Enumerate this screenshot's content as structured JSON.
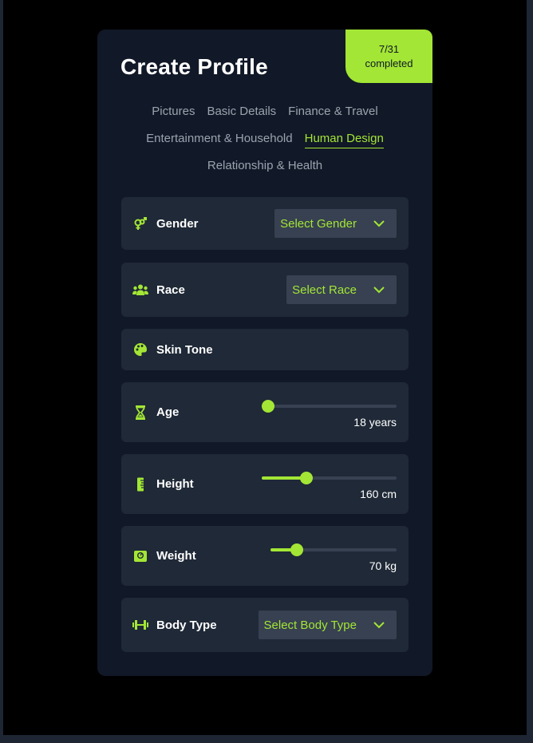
{
  "header": {
    "title": "Create Profile",
    "progress_count": "7/31",
    "progress_label": "completed"
  },
  "tabs": [
    {
      "label": "Pictures",
      "active": false
    },
    {
      "label": "Basic Details",
      "active": false
    },
    {
      "label": "Finance & Travel",
      "active": false
    },
    {
      "label": "Entertainment & Household",
      "active": false
    },
    {
      "label": "Human Design",
      "active": true
    },
    {
      "label": "Relationship & Health",
      "active": false
    }
  ],
  "fields": {
    "gender": {
      "label": "Gender",
      "icon": "gender-icon",
      "select": "Select Gender"
    },
    "race": {
      "label": "Race",
      "icon": "users-icon",
      "select": "Select Race"
    },
    "skin_tone": {
      "label": "Skin Tone",
      "icon": "palette-icon"
    },
    "age": {
      "label": "Age",
      "icon": "hourglass-icon",
      "value_text": "18 years",
      "level": 0
    },
    "height": {
      "label": "Height",
      "icon": "ruler-icon",
      "value_text": "160 cm",
      "level": 0.33
    },
    "weight": {
      "label": "Weight",
      "icon": "weight-scale-icon",
      "value_text": "70 kg",
      "level": 0.21
    },
    "body_type": {
      "label": "Body Type",
      "icon": "dumbbell-icon",
      "select": "Select Body Type"
    }
  },
  "colors": {
    "accent": "#a3e635",
    "card_background": "#111827",
    "field_background": "#1f2937",
    "muted_text": "#9ca3af"
  }
}
